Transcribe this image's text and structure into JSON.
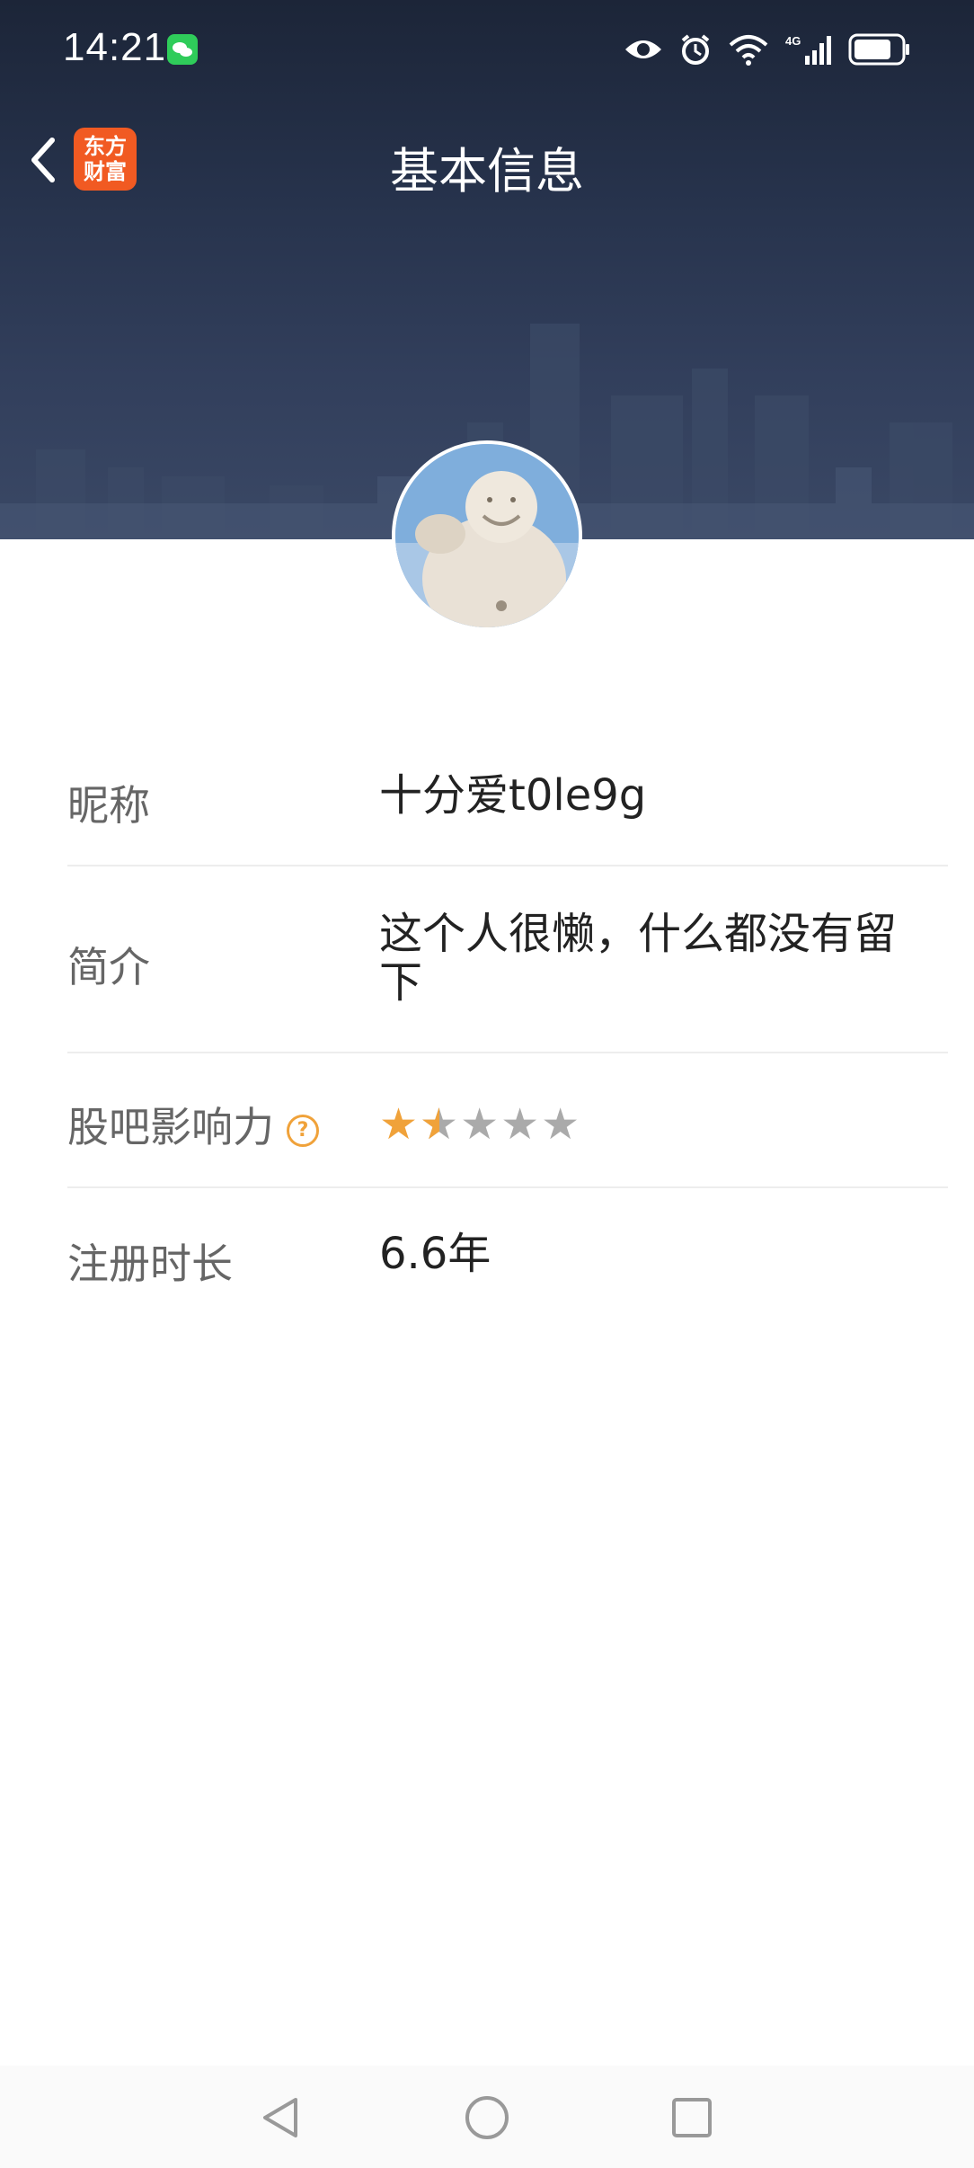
{
  "status_bar": {
    "time": "14:21",
    "icons": [
      "wechat-icon",
      "eye-icon",
      "alarm-icon",
      "wifi-icon",
      "signal-4g-icon",
      "battery-icon"
    ]
  },
  "nav": {
    "back_icon": "chevron-left-icon",
    "app_logo_text_line1": "东方",
    "app_logo_text_line2": "财富",
    "title": "基本信息"
  },
  "profile": {
    "avatar_icon": "avatar-image",
    "rows": [
      {
        "label": "昵称",
        "value": "十分爱t0le9g"
      },
      {
        "label": "简介",
        "value": "这个人很懒，什么都没有留下"
      },
      {
        "label": "股吧影响力",
        "help": "?",
        "stars_total": 5,
        "stars_filled": 1.5
      },
      {
        "label": "注册时长",
        "value": "6.6年"
      }
    ]
  },
  "colors": {
    "banner_dark": "#1c2538",
    "accent_orange": "#f0a23a",
    "app_badge": "#f15a22",
    "wechat_green": "#2fcc5a"
  }
}
